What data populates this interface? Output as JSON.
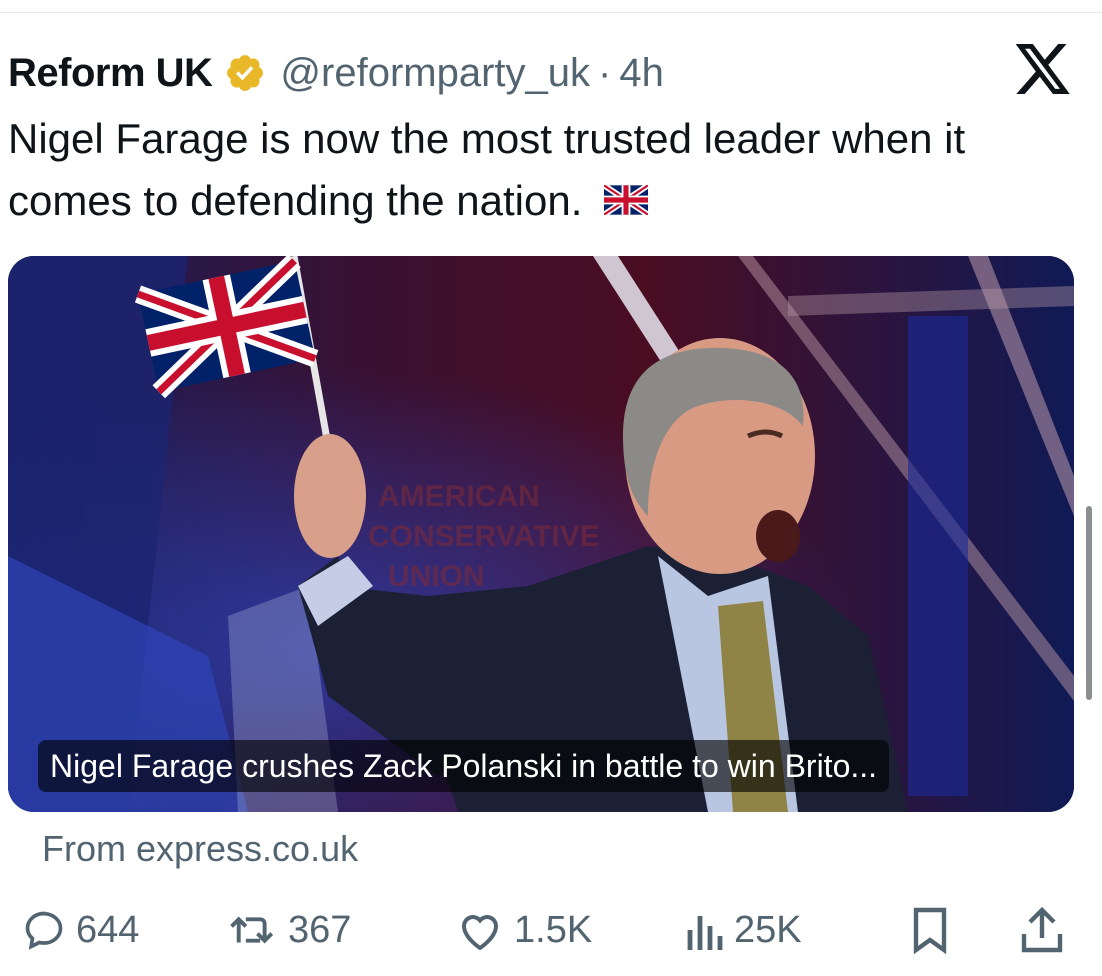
{
  "post": {
    "display_name": "Reform UK",
    "handle": "@reformparty_uk",
    "separator": "·",
    "time": "4h",
    "text": "Nigel Farage is now the most trusted leader when it comes to defending the nation.",
    "text_emoji": "union-jack-flag-emoji",
    "platform_icon": "x-logo-icon"
  },
  "link_card": {
    "caption": "Nigel Farage crushes Zack Polanski in battle to win Brito...",
    "source": "From express.co.uk"
  },
  "actions": {
    "replies": "644",
    "reposts": "367",
    "likes": "1.5K",
    "views": "25K"
  },
  "colors": {
    "text_primary": "#0f1419",
    "text_secondary": "#536471",
    "verified_gold": "#e8b829"
  }
}
